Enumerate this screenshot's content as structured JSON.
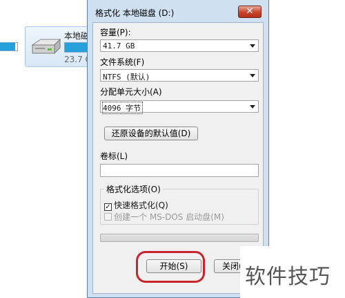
{
  "background": {
    "drive_name": "本地磁",
    "drive_free": "23.7 G"
  },
  "dialog": {
    "title": "格式化 本地磁盘 (D:)",
    "close_label": "✕",
    "capacity": {
      "label": "容量(P):",
      "value": "41.7 GB"
    },
    "filesystem": {
      "label": "文件系统(F)",
      "value": "NTFS (默认)"
    },
    "allocation": {
      "label": "分配单元大小(A)",
      "value": "4096 字节"
    },
    "restore_button": "还原设备的默认值(D)",
    "volume_label": {
      "label": "卷标(L)",
      "value": ""
    },
    "options": {
      "title": "格式化选项(O)",
      "quick_format": {
        "label": "快速格式化(Q)",
        "checked": true
      },
      "msdos_boot": {
        "label": "创建一个 MS-DOS 启动盘(M)",
        "checked": false,
        "enabled": false
      }
    },
    "progress": 0,
    "start_button": "开始(S)",
    "close_button": "关闭(C"
  },
  "watermark": "软件技巧",
  "colors": {
    "accent": "#26a0da",
    "dialog_frame": "#cfe0f1",
    "highlight": "#c9232b"
  }
}
